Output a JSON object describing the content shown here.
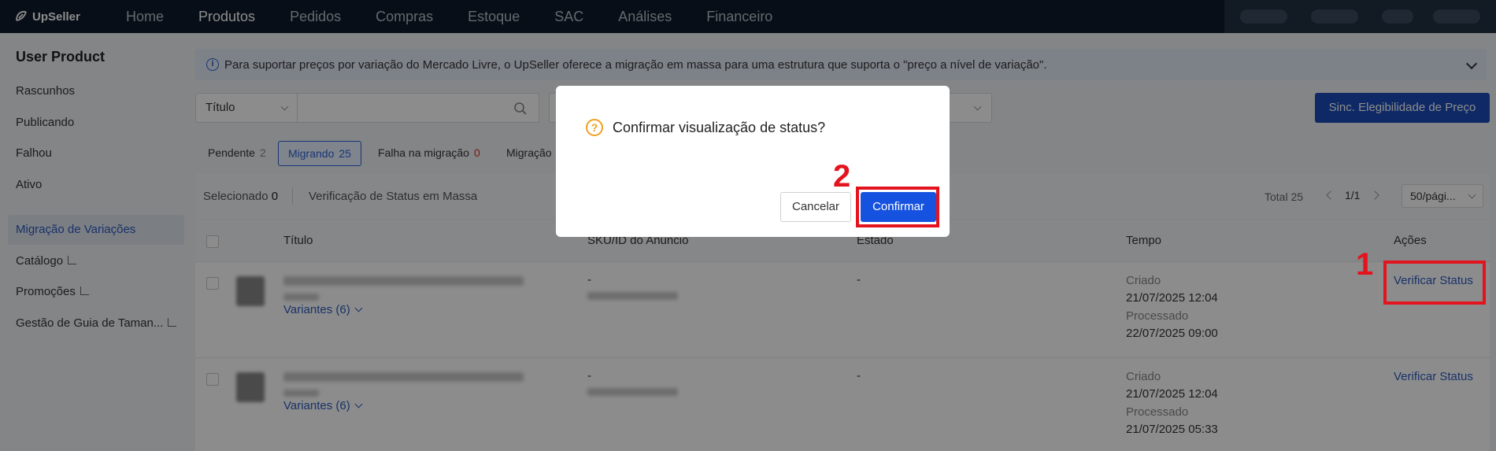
{
  "nav": {
    "logo": "UpSeller",
    "items": [
      "Home",
      "Produtos",
      "Pedidos",
      "Compras",
      "Estoque",
      "SAC",
      "Análises",
      "Financeiro"
    ],
    "active": "Produtos"
  },
  "sidebar": {
    "title": "User Product",
    "items": [
      "Rascunhos",
      "Publicando",
      "Falhou",
      "Ativo",
      "Migração de Variações",
      "Catálogo",
      "Promoções",
      "Gestão de Guia de Taman..."
    ],
    "active": "Migração de Variações"
  },
  "info_bar": {
    "icon": "info-icon",
    "text": "Para suportar preços por variação do Mercado Livre, o UpSeller oferece a migração em massa para uma estrutura que suporta o \"preço a nível de variação\"."
  },
  "search": {
    "field_select": "Título",
    "value": "",
    "sync_button": "Sinc. Elegibilidade de Preço"
  },
  "tabs": [
    {
      "label": "Pendente",
      "count": "2"
    },
    {
      "label": "Migrando",
      "count": "25"
    },
    {
      "label": "Falha na migração",
      "count": "0"
    },
    {
      "label": "Migração",
      "count": ""
    }
  ],
  "toolbar": {
    "selected_label": "Selecionado",
    "selected_count": "0",
    "mass_check": "Verificação de Status em Massa",
    "total_label": "Total",
    "total_count": "25",
    "page": "1/1",
    "page_size": "50/pági..."
  },
  "table": {
    "columns": [
      "Título",
      "SKU/ID do Anúncio",
      "Estado",
      "Tempo",
      "Ações"
    ],
    "rows": [
      {
        "variants": "Variantes (6)",
        "sku": "-",
        "status": "-",
        "created_label": "Criado",
        "created": "21/07/2025 12:04",
        "processed_label": "Processado",
        "processed": "22/07/2025 09:00",
        "action": "Verificar Status"
      },
      {
        "variants": "Variantes (6)",
        "sku": "-",
        "status": "-",
        "created_label": "Criado",
        "created": "21/07/2025 12:04",
        "processed_label": "Processado",
        "processed": "21/07/2025 05:33",
        "action": "Verificar Status"
      }
    ]
  },
  "dialog": {
    "icon": "question-icon",
    "title": "Confirmar visualização de status?",
    "cancel": "Cancelar",
    "confirm": "Confirmar"
  },
  "annotations": {
    "step1": "1",
    "step2": "2",
    "color": "#e3141e"
  }
}
